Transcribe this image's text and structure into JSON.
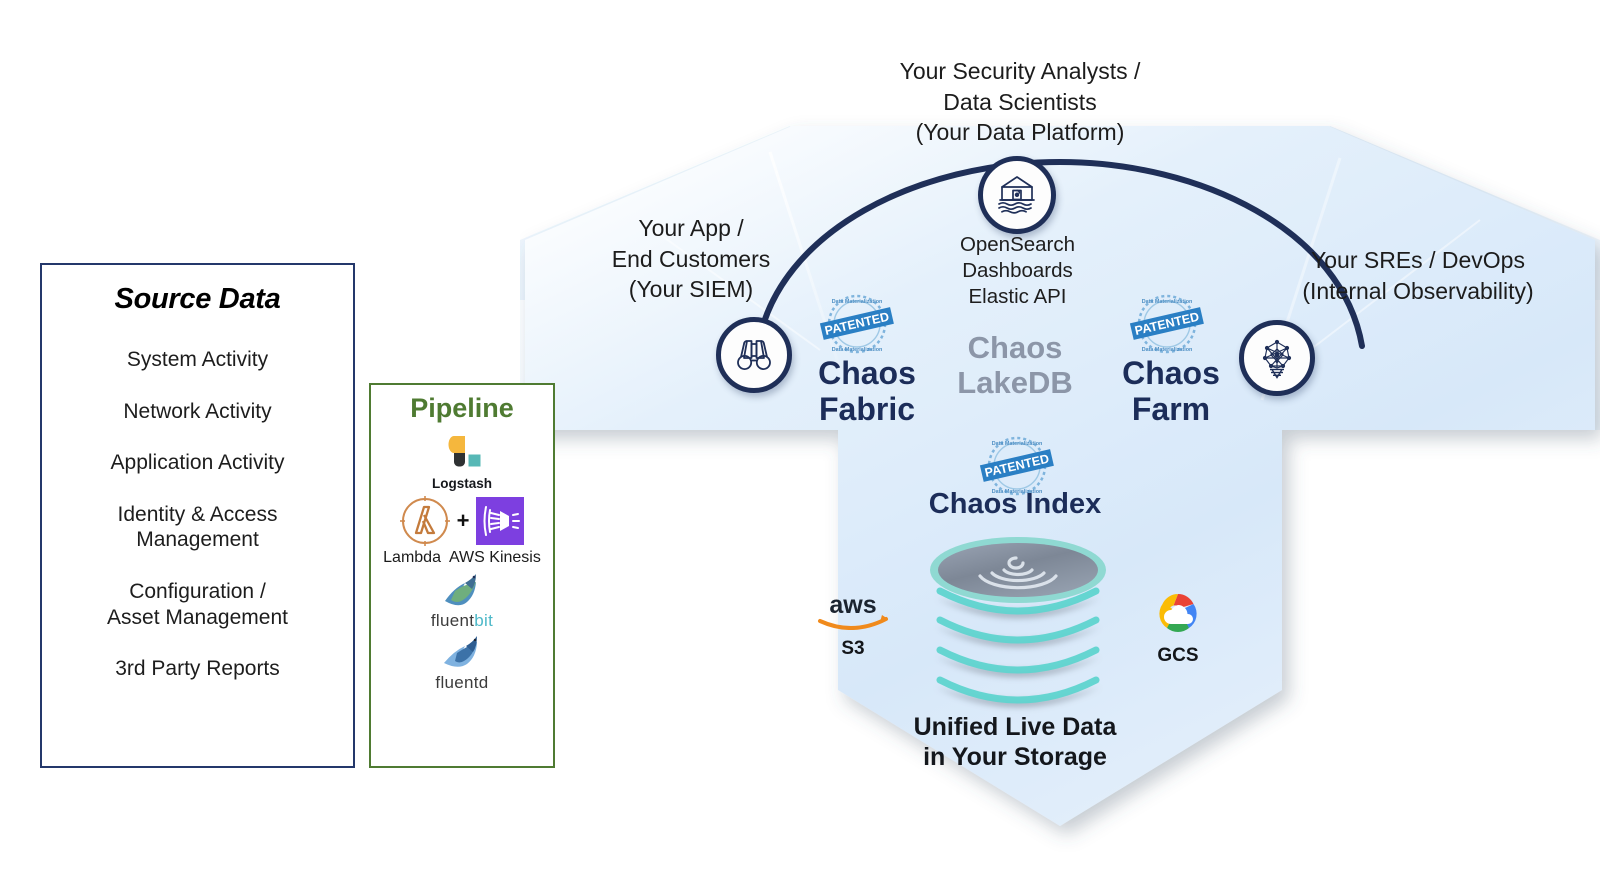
{
  "source_panel": {
    "title": "Source Data",
    "items": [
      "System Activity",
      "Network Activity",
      "Application Activity",
      "Identity & Access\nManagement",
      "Configuration /\nAsset Management",
      "3rd Party Reports"
    ]
  },
  "pipeline_panel": {
    "title": "Pipeline",
    "tools": [
      {
        "name": "Logstash",
        "icon": "logstash-icon"
      },
      {
        "name": "Lambda",
        "icon": "aws-lambda-icon"
      },
      {
        "name": "AWS Kinesis",
        "icon": "aws-kinesis-icon"
      },
      {
        "name": "fluentbit",
        "icon": "fluentbit-icon"
      },
      {
        "name": "fluentd",
        "icon": "fluentd-icon"
      }
    ],
    "plus_symbol": "+",
    "fluentbit_prefix": "fluent",
    "fluentbit_suffix": "bit"
  },
  "consumers": {
    "analysts": "Your Security Analysts /\nData Scientists\n(Your Data Platform)",
    "app": "Your App /\nEnd Customers\n(Your SIEM)",
    "sre": "Your SREs / DevOps\n(Internal Observability)"
  },
  "interfaces": {
    "api_stack": "OpenSearch\nDashboards\nElastic API"
  },
  "products": {
    "fabric": "Chaos\nFabric",
    "farm": "Chaos\nFarm",
    "lakedb": "Chaos\nLakeDB",
    "index": "Chaos Index"
  },
  "storage": {
    "unified_label": "Unified Live Data\nin Your Storage",
    "aws_wordmark": "aws",
    "aws_service": "S3",
    "gcs_label": "GCS"
  },
  "badges": {
    "text": "PATENTED",
    "ring_text": "Data Materialization"
  },
  "icons": {
    "opensearch": "lakehouse-icon",
    "app": "binoculars-icon",
    "sre": "network-graph-icon"
  },
  "colors": {
    "deep_navy": "#1c2d59",
    "panel_border_navy": "#24386b",
    "pipeline_green": "#4f7b32",
    "shield_fill": "#dbeafa",
    "lakedb_gray": "#8c96a8",
    "badge_blue": "#2a7fc4",
    "teal": "#5fd4cf",
    "aws_orange": "#f08a1c"
  }
}
